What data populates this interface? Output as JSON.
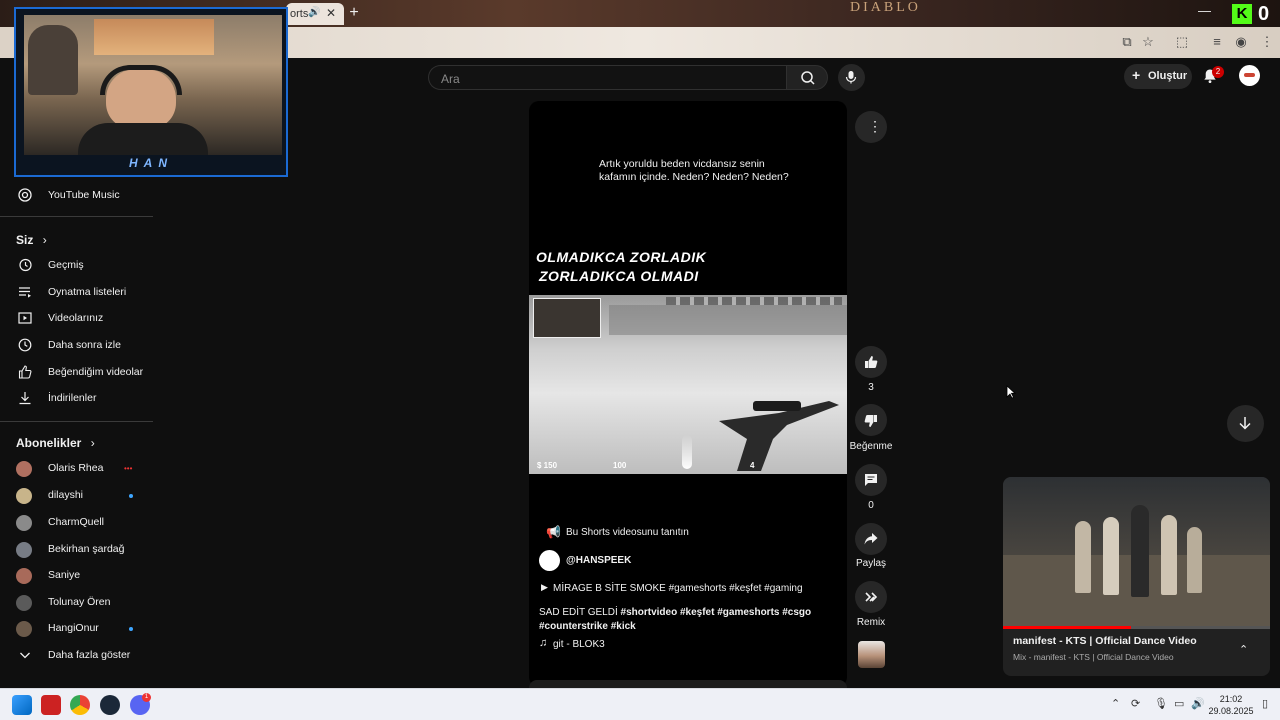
{
  "browser": {
    "tab_fragment": "orts",
    "game_title": "DIABLO",
    "kick_count": "0"
  },
  "youtube": {
    "search": {
      "placeholder": "Ara"
    },
    "create_label": "Oluştur",
    "notifications_count": "2",
    "sidebar": {
      "music_label": "YouTube Music",
      "you_heading": "Siz",
      "you_items": [
        "Geçmiş",
        "Oynatma listeleri",
        "Videolarınız",
        "Daha sonra izle",
        "Beğendiğim videolar",
        "İndirilenler"
      ],
      "subs_heading": "Abonelikler",
      "subscriptions": [
        {
          "name": "Olaris Rhea",
          "status": "live",
          "color": "#b07060"
        },
        {
          "name": "dilayshi",
          "status": "new",
          "color": "#c8b48a"
        },
        {
          "name": "CharmQuell",
          "status": "",
          "color": "#8a8a8a"
        },
        {
          "name": "Bekirhan şardağ",
          "status": "",
          "color": "#777c85"
        },
        {
          "name": "Saniye",
          "status": "",
          "color": "#a86a5a"
        },
        {
          "name": "Tolunay Ören",
          "status": "",
          "color": "#5a5a5a"
        },
        {
          "name": "HangiOnur",
          "status": "new",
          "color": "#6b5a4a"
        }
      ],
      "show_more": "Daha fazla göster"
    },
    "short": {
      "caption": "Artık yoruldu beden vicdansız senin kafamın içinde. Neden? Neden? Neden?",
      "overlay_line1": "OLMADIKCA ZORLADIK",
      "overlay_line2": "ZORLADIKCA OLMADI",
      "promo": "Bu Shorts videosunu tanıtın",
      "channel": "@HANSPEEK",
      "title": "MİRAGE B SİTE SMOKE #gameshorts #keşfet #gaming",
      "description_plain": "SAD EDİT GELDİ",
      "description_tags": "#shortvideo #keşfet #gameshorts #csgo #counterstrike #kick",
      "sound": "git - BLOK3",
      "likes": "3",
      "dislike_label": "Beğenme",
      "comments": "0",
      "share_label": "Paylaş",
      "remix_label": "Remix",
      "hud_money": "$ 150",
      "hud_ammo": "100",
      "hud_clip": "4"
    },
    "miniplayer": {
      "title": "manifest - KTS | Official Dance Video",
      "subtitle": "Mix - manifest - KTS | Official Dance Video",
      "progress": 0.48
    }
  },
  "webcam": {
    "name": "HAN"
  },
  "taskbar": {
    "time": "21:02",
    "date": "29.08.2025",
    "discord_badge": "1"
  }
}
